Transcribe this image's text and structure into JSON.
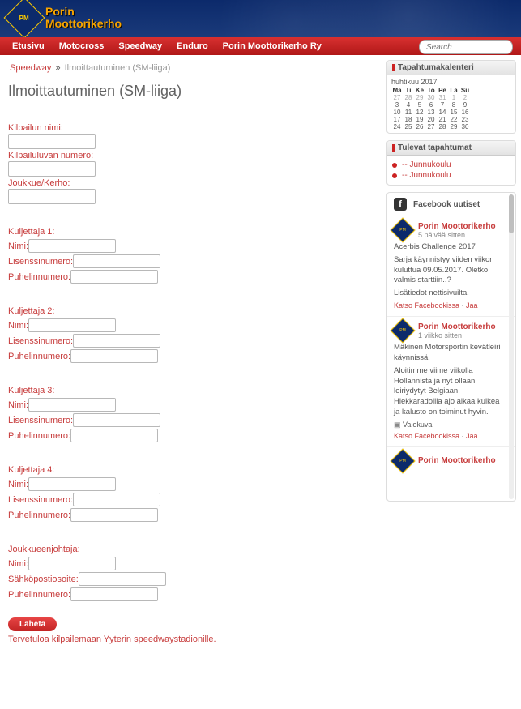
{
  "site": {
    "name_line1": "Porin",
    "name_line2": "Moottorikerho"
  },
  "nav": {
    "items": [
      "Etusivu",
      "Motocross",
      "Speedway",
      "Enduro",
      "Porin Moottorikerho Ry"
    ],
    "search_placeholder": "Search"
  },
  "breadcrumb": {
    "a": "Speedway",
    "sep": "»",
    "b": "Ilmoittautuminen (SM-liiga)"
  },
  "page_title": "Ilmoittautuminen (SM-liiga)",
  "form": {
    "comp_name_label": "Kilpailun nimi:",
    "comp_num_label": "Kilpailuluvan numero:",
    "team_label": "Joukkue/Kerho:",
    "drivers": [
      {
        "title": "Kuljettaja 1:"
      },
      {
        "title": "Kuljettaja 2:"
      },
      {
        "title": "Kuljettaja 3:"
      },
      {
        "title": "Kuljettaja 4:"
      }
    ],
    "driver_name_label": "Nimi:",
    "driver_lic_label": "Lisenssinumero:",
    "driver_phone_label": "Puhelinnumero:",
    "leader_title": "Joukkueenjohtaja:",
    "leader_name_label": "Nimi:",
    "leader_email_label": "Sähköpostiosoite:",
    "leader_phone_label": "Puhelinnumero:",
    "submit": "Lähetä",
    "footer": "Tervetuloa kilpailemaan Yyterin speedwaystadionille."
  },
  "calendar": {
    "title": "Tapahtumakalenteri",
    "month": "huhtikuu 2017",
    "weekdays": [
      "Ma",
      "Ti",
      "Ke",
      "To",
      "Pe",
      "La",
      "Su"
    ],
    "rows": [
      [
        "27",
        "28",
        "29",
        "30",
        "31",
        "1",
        "2"
      ],
      [
        "3",
        "4",
        "5",
        "6",
        "7",
        "8",
        "9"
      ],
      [
        "10",
        "11",
        "12",
        "13",
        "14",
        "15",
        "16"
      ],
      [
        "17",
        "18",
        "19",
        "20",
        "21",
        "22",
        "23"
      ],
      [
        "24",
        "25",
        "26",
        "27",
        "28",
        "29",
        "30"
      ]
    ]
  },
  "upcoming": {
    "title": "Tulevat tapahtumat",
    "items": [
      "-- Junnukoulu",
      "-- Junnukoulu"
    ]
  },
  "fb": {
    "header": "Facebook uutiset",
    "posts": [
      {
        "name": "Porin Moottorikerho",
        "time": "5 päivää sitten",
        "body": [
          "Acerbis Challenge 2017",
          "Sarja käynnistyy viiden viikon kuluttua 09.05.2017. Oletko valmis starttiin..?",
          "Lisätiedot nettisivuilta."
        ],
        "links": "Katso Facebookissa · Jaa"
      },
      {
        "name": "Porin Moottorikerho",
        "time": "1 viikko sitten",
        "body": [
          "Mäkinen Motorsportin kevätleiri käynnissä.",
          "Aloitimme viime viikolla Hollannista ja nyt ollaan leiriydytyt Belgiaan. Hiekkaradoilla ajo alkaa kulkea ja kalusto on toiminut hyvin."
        ],
        "photo": "Valokuva",
        "links": "Katso Facebookissa · Jaa"
      },
      {
        "name": "Porin Moottorikerho",
        "time": "",
        "body": [],
        "links": ""
      }
    ]
  }
}
